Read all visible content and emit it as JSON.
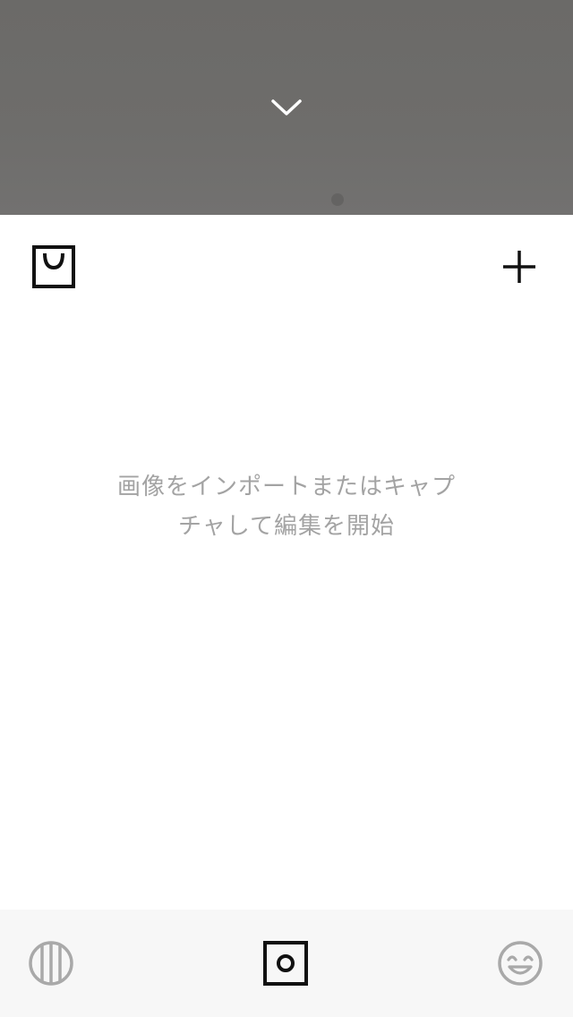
{
  "camera": {
    "collapse_icon": "chevron-down-icon"
  },
  "toolbar": {
    "store_icon": "shopping-bag-icon",
    "add_icon": "plus-icon"
  },
  "empty_state": {
    "message": "画像をインポートまたはキャプ\nチャして編集を開始"
  },
  "tabbar": {
    "tabs": [
      {
        "icon": "filters-stripes-icon",
        "active": false
      },
      {
        "icon": "camera-shutter-icon",
        "active": true
      },
      {
        "icon": "smiley-face-icon",
        "active": false
      }
    ]
  },
  "colors": {
    "camera_bg": "#6d6c6a",
    "icon_dark": "#111111",
    "icon_inactive": "#a9a9a9",
    "message_text": "#a3a3a3",
    "tabbar_bg": "#f7f7f7"
  }
}
